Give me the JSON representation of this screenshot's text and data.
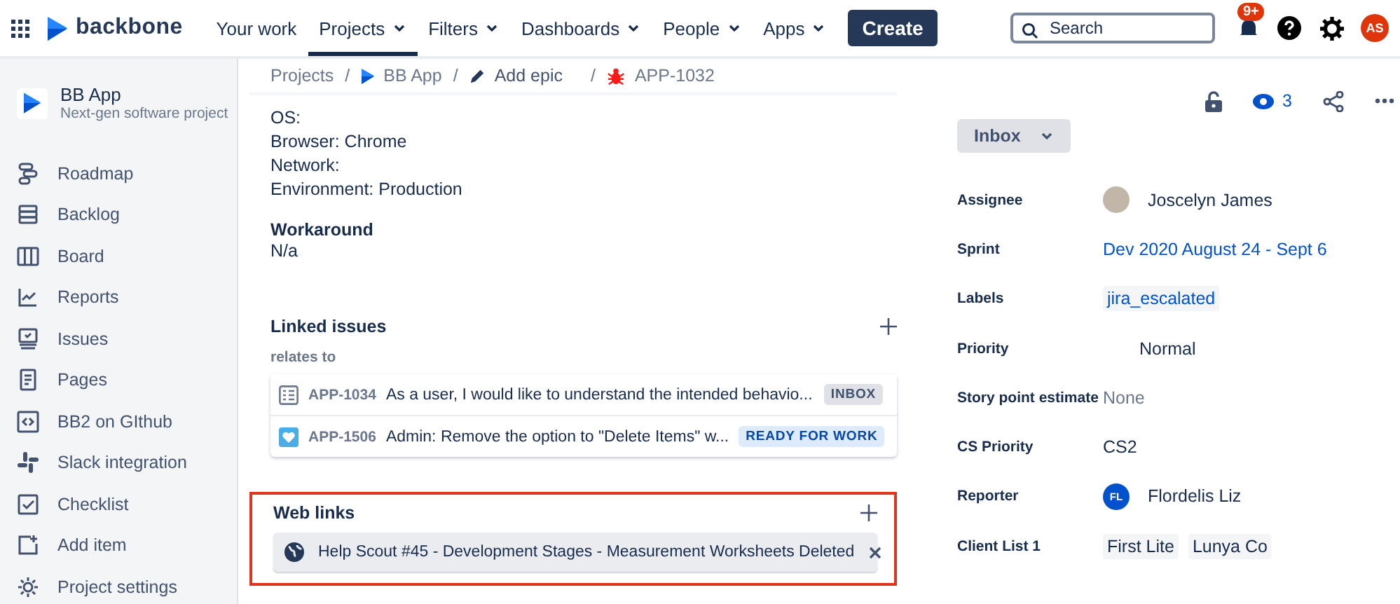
{
  "header": {
    "logo": "backbone",
    "nav": [
      {
        "label": "Your work",
        "has_menu": false,
        "selected": false
      },
      {
        "label": "Projects",
        "has_menu": true,
        "selected": true
      },
      {
        "label": "Filters",
        "has_menu": true,
        "selected": false
      },
      {
        "label": "Dashboards",
        "has_menu": true,
        "selected": false
      },
      {
        "label": "People",
        "has_menu": true,
        "selected": false
      },
      {
        "label": "Apps",
        "has_menu": true,
        "selected": false
      }
    ],
    "create": "Create",
    "search": {
      "placeholder": "Search"
    },
    "notification_badge": "9+",
    "avatar_initials": "AS"
  },
  "sidebar": {
    "project_name": "BB App",
    "project_type": "Next-gen software project",
    "items": [
      {
        "label": "Roadmap"
      },
      {
        "label": "Backlog"
      },
      {
        "label": "Board"
      },
      {
        "label": "Reports"
      },
      {
        "label": "Issues"
      },
      {
        "label": "Pages"
      },
      {
        "label": "BB2 on GIthub"
      },
      {
        "label": "Slack integration"
      },
      {
        "label": "Checklist"
      },
      {
        "label": "Add item"
      },
      {
        "label": "Project settings"
      }
    ]
  },
  "breadcrumbs": {
    "separator": "/",
    "items": [
      {
        "label": "Projects"
      },
      {
        "label": "BB App"
      },
      {
        "label": "Add epic"
      },
      {
        "label": "APP-1032"
      }
    ]
  },
  "description_lines": [
    "OS:",
    "Browser: Chrome",
    "Network:",
    "Environment: Production"
  ],
  "workaround": {
    "title": "Workaround",
    "text": "N/a"
  },
  "linked_issues": {
    "title": "Linked issues",
    "relation": "relates to",
    "items": [
      {
        "key": "APP-1034",
        "summary": "As a user, I would like to understand the intended behavio...",
        "status": "INBOX"
      },
      {
        "key": "APP-1506",
        "summary": "Admin: Remove the option to \"Delete Items\" w...",
        "status": "READY FOR WORK"
      }
    ]
  },
  "web_links": {
    "title": "Web links",
    "highlighted": true,
    "items": [
      {
        "title": "Help Scout #45 - Development Stages - Measurement Worksheets Deleted"
      }
    ]
  },
  "panel": {
    "watchers": "3",
    "status": "Inbox",
    "fields": [
      {
        "label": "Assignee",
        "kind": "user",
        "values": [
          "Joscelyn James"
        ]
      },
      {
        "label": "Sprint",
        "kind": "link",
        "values": [
          "Dev 2020 August 24 - Sept 6"
        ]
      },
      {
        "label": "Labels",
        "kind": "labels",
        "values": [
          "jira_escalated"
        ]
      },
      {
        "label": "Priority",
        "kind": "priority",
        "values": [
          "Normal"
        ]
      },
      {
        "label": "Story point estimate",
        "kind": "empty",
        "values": [
          "None"
        ]
      },
      {
        "label": "CS Priority",
        "kind": "text",
        "values": [
          "CS2"
        ]
      },
      {
        "label": "Reporter",
        "kind": "initials-user",
        "initials": "FL",
        "values": [
          "Flordelis Liz"
        ]
      },
      {
        "label": "Client List 1",
        "kind": "tags",
        "values": [
          "First Lite",
          "Lunya Co"
        ]
      }
    ]
  }
}
